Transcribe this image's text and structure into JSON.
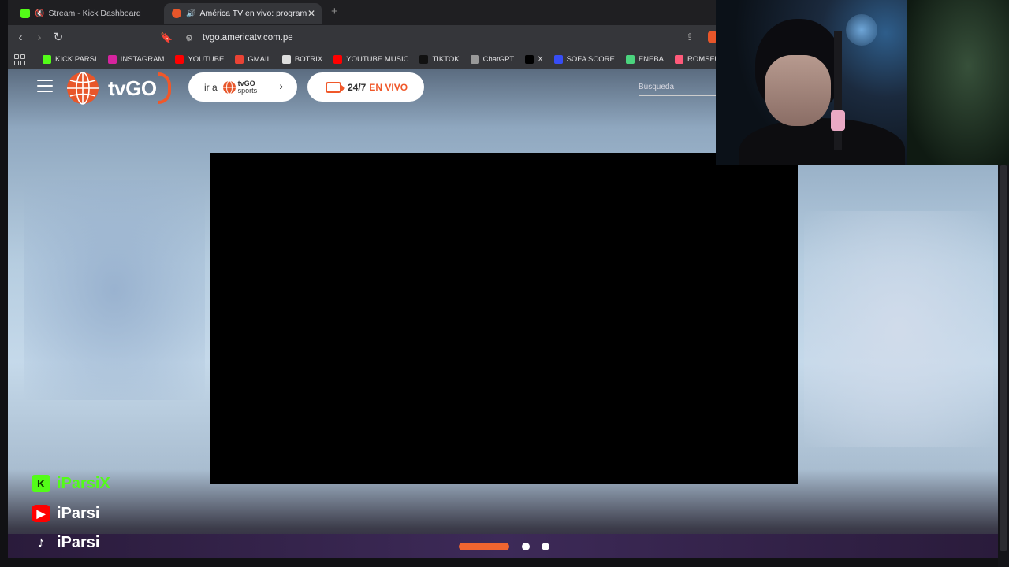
{
  "browser": {
    "tabs": [
      {
        "title": "Stream - Kick Dashboard",
        "active": false,
        "favicon_color": "#53fc18"
      },
      {
        "title": "América TV en vivo: program",
        "active": true,
        "favicon_color": "#e8562a"
      }
    ],
    "url": "tvgo.americatv.com.pe",
    "bookmarks": [
      {
        "label": "KICK PARSI",
        "icon": "kick-icon",
        "color": "#53fc18"
      },
      {
        "label": "INSTAGRAM",
        "icon": "instagram-icon",
        "color": "#d6249f"
      },
      {
        "label": "YOUTUBE",
        "icon": "youtube-icon",
        "color": "#ff0000"
      },
      {
        "label": "GMAIL",
        "icon": "gmail-icon",
        "color": "#ea4335"
      },
      {
        "label": "BOTRIX",
        "icon": "botrix-icon",
        "color": "#dddddd"
      },
      {
        "label": "YOUTUBE MUSIC",
        "icon": "youtube-music-icon",
        "color": "#ff0000"
      },
      {
        "label": "TIKTOK",
        "icon": "tiktok-icon",
        "color": "#111111"
      },
      {
        "label": "ChatGPT",
        "icon": "chatgpt-icon",
        "color": "#999999"
      },
      {
        "label": "X",
        "icon": "x-icon",
        "color": "#000000"
      },
      {
        "label": "SOFA SCORE",
        "icon": "sofascore-icon",
        "color": "#374df5"
      },
      {
        "label": "ENEBA",
        "icon": "eneba-icon",
        "color": "#4bd47e"
      },
      {
        "label": "ROMSFUN",
        "icon": "romsfun-icon",
        "color": "#ff5a7a"
      }
    ]
  },
  "site": {
    "logo_text": "tvGO",
    "sports_pill": {
      "prefix": "ir a",
      "brand_top": "tvGO",
      "brand_bottom": "sports"
    },
    "live_pill": {
      "label": "24/7",
      "live": "EN VIVO"
    },
    "search_placeholder": "Búsqueda",
    "carousel": {
      "slides": 3,
      "active": 1
    }
  },
  "overlay": {
    "socials": [
      {
        "platform": "kick",
        "handle": "iParsiX",
        "icon": "K"
      },
      {
        "platform": "youtube",
        "handle": "iParsi",
        "icon": "▶"
      },
      {
        "platform": "tiktok",
        "handle": "iParsi",
        "icon": "♪"
      }
    ]
  },
  "colors": {
    "accent": "#f0582a",
    "kick": "#53fc18"
  }
}
